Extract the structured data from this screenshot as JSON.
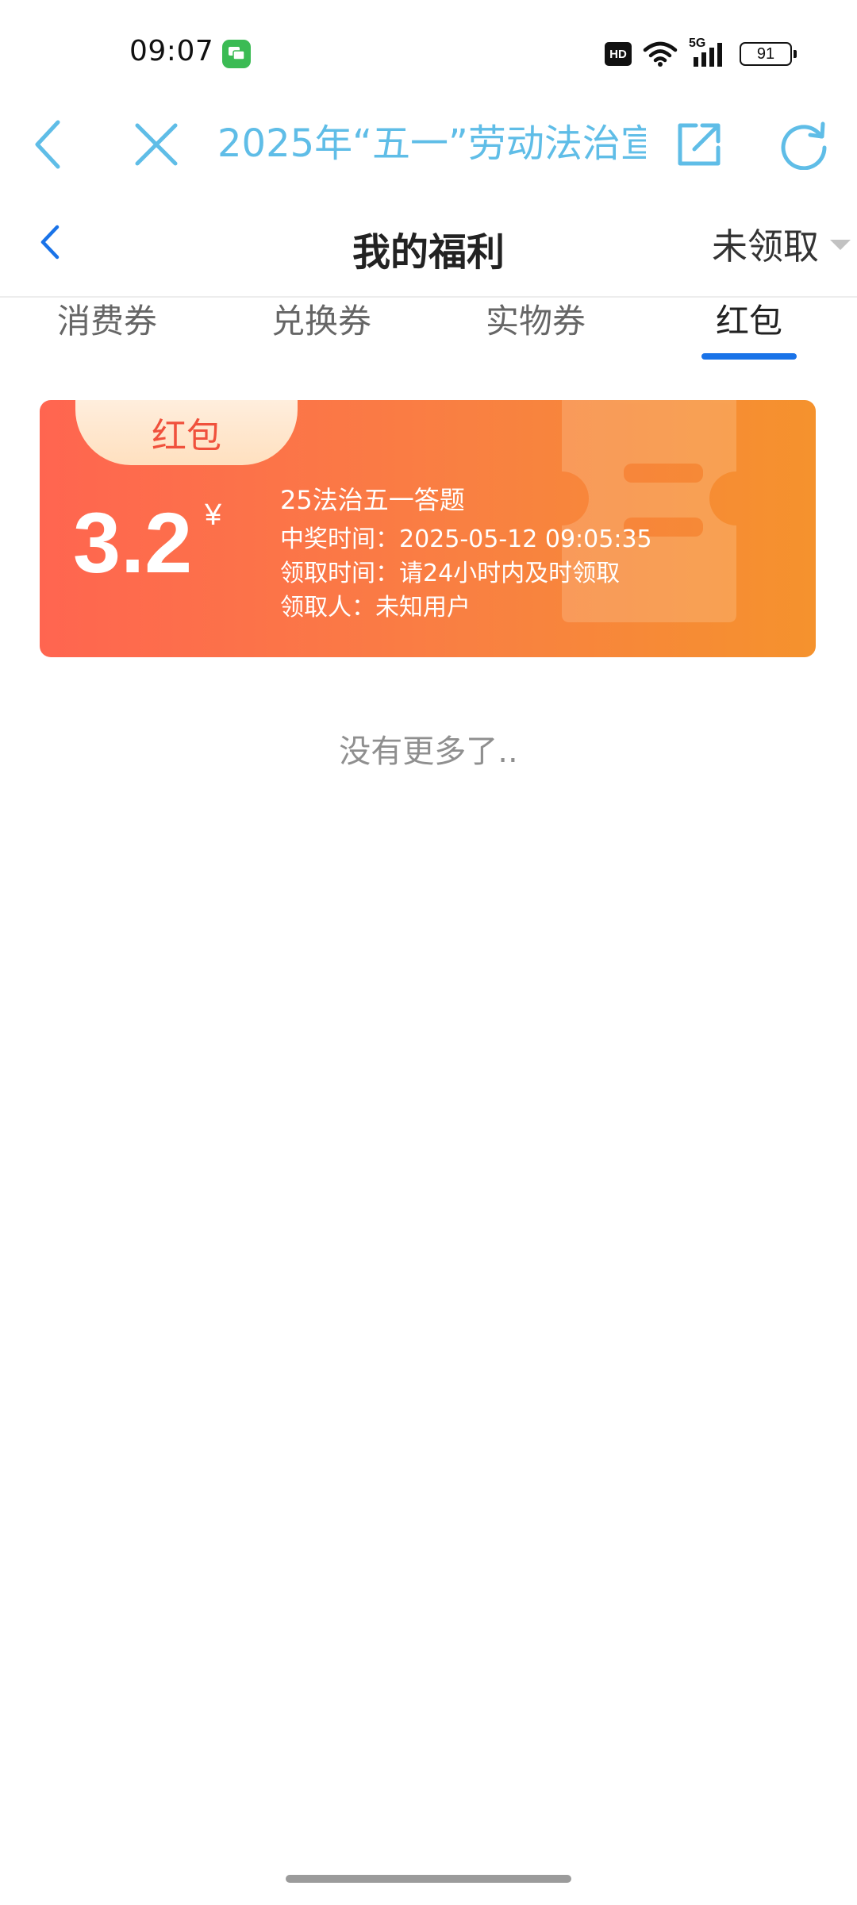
{
  "status_bar": {
    "time": "09:07",
    "hd_label": "HD",
    "network": "5G",
    "battery": "91"
  },
  "browser": {
    "title": "2025年“五一”劳动法治宣",
    "icons": [
      "back-icon",
      "close-icon",
      "share-icon",
      "refresh-icon"
    ],
    "accent_color": "#5fbde7"
  },
  "header": {
    "title": "我的福利",
    "filter_label": "未领取"
  },
  "tabs": [
    {
      "label": "消费券",
      "active": false
    },
    {
      "label": "兑换券",
      "active": false
    },
    {
      "label": "实物券",
      "active": false
    },
    {
      "label": "红包",
      "active": true
    }
  ],
  "card": {
    "tag": "红包",
    "amount": "3.2",
    "currency": "¥",
    "activity": "25法治五一答题",
    "win_time": "中奖时间：2025-05-12 09:05:35",
    "claim_time": "领取时间：请24小时内及时领取",
    "recipient": "领取人：未知用户"
  },
  "footer_text": "没有更多了.."
}
